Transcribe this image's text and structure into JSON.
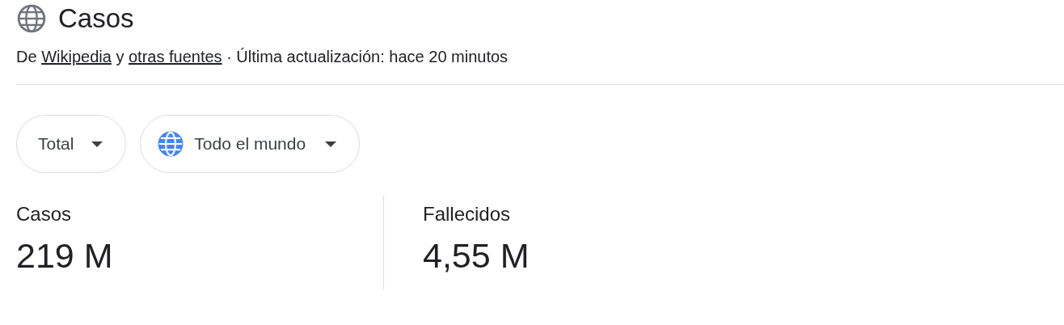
{
  "header": {
    "title": "Casos"
  },
  "subtitle": [
    {
      "kind": "text",
      "text": "De"
    },
    {
      "kind": "link",
      "text": "Wikipedia"
    },
    {
      "kind": "text",
      "text": "y"
    },
    {
      "kind": "link",
      "text": "otras fuentes"
    },
    {
      "kind": "text",
      "text": "· Última actualización: hace 20 minutos"
    }
  ],
  "filters": [
    {
      "label": "Total",
      "kind": "plain"
    },
    {
      "label": "Todo el mundo",
      "kind": "globe"
    }
  ],
  "stats": [
    {
      "label": "Casos",
      "value": "219 M"
    },
    {
      "label": "Fallecidos",
      "value": "4,55 M"
    }
  ]
}
